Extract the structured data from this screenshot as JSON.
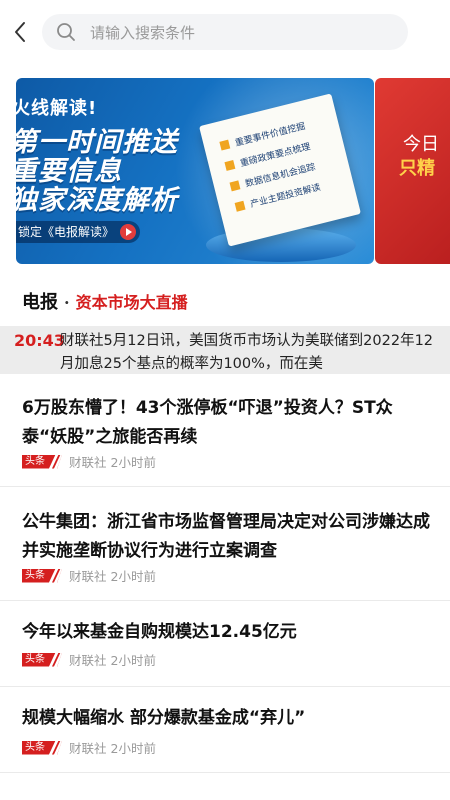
{
  "search": {
    "placeholder": "请输入搜索条件"
  },
  "banner": {
    "kicker": "火线解读!",
    "headline": [
      "第一时间推送",
      "重要信息",
      "独家深度解析"
    ],
    "doc_lines": [
      "重要事件价值挖掘",
      "重磅政策要点梳理",
      "数据信息机会追踪",
      "产业主题投资解读"
    ],
    "pill": "锁定《电报解读》",
    "second_card": [
      "今日",
      "只精"
    ],
    "active_index": 1,
    "total": 2
  },
  "section": {
    "title": "电报",
    "separator": "·",
    "subtitle": "资本市场大直播"
  },
  "live": {
    "time": "20:43",
    "text": "财联社5月12日讯，美国货币市场认为美联储到2022年12月加息25个基点的概率为100%，而在美"
  },
  "news": [
    {
      "title": "6万股东懵了！43个涨停板“吓退”投资人？ST众泰“妖股”之旅能否再续",
      "tag": "头条",
      "source": "财联社",
      "time": "2小时前"
    },
    {
      "title": "公牛集团：浙江省市场监督管理局决定对公司涉嫌达成并实施垄断协议行为进行立案调查",
      "tag": "头条",
      "source": "财联社",
      "time": "2小时前"
    },
    {
      "title": "今年以来基金自购规模达12.45亿元",
      "tag": "头条",
      "source": "财联社",
      "time": "2小时前"
    },
    {
      "title": "规模大幅缩水 部分爆款基金成“弃儿”",
      "tag": "头条",
      "source": "财联社",
      "time": "2小时前"
    }
  ],
  "colors": {
    "accent": "#d51f1f",
    "banner_blue": "#1572c3",
    "muted": "#9a9a9a"
  }
}
